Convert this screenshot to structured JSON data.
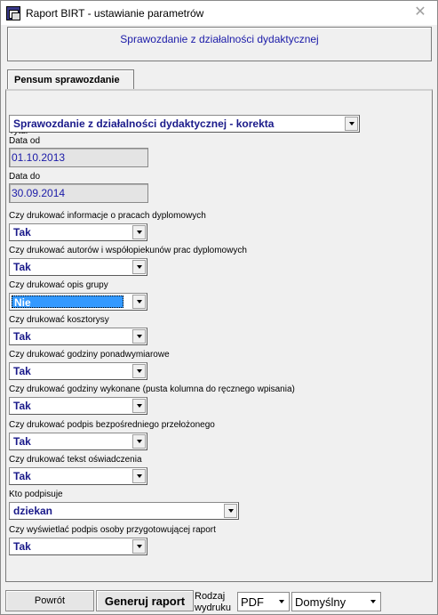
{
  "window": {
    "title": "Raport BIRT - ustawianie parametrów",
    "close_glyph": "✕"
  },
  "header": {
    "report_name": "Sprawozdanie z działalności dydaktycznej"
  },
  "tabs": [
    {
      "label": "Pensum sprawozdanie"
    }
  ],
  "form": {
    "tytul": {
      "label": "Tytuł",
      "value": "Sprawozdanie z działalności dydaktycznej - korekta"
    },
    "data_od": {
      "label": "Data od",
      "value": "01.10.2013"
    },
    "data_do": {
      "label": "Data do",
      "value": "30.09.2014"
    },
    "params": [
      {
        "label": "Czy drukować informacje o pracach dyplomowych",
        "value": "Tak"
      },
      {
        "label": "Czy drukować autorów i współopiekunów prac dyplomowych",
        "value": "Tak"
      },
      {
        "label": "Czy drukować opis grupy",
        "value": "Nie"
      },
      {
        "label": "Czy drukować kosztorysy",
        "value": "Tak"
      },
      {
        "label": "Czy drukować godziny ponadwymiarowe",
        "value": "Tak"
      },
      {
        "label": "Czy drukować godziny wykonane (pusta kolumna do ręcznego wpisania)",
        "value": "Tak"
      },
      {
        "label": "Czy drukować podpis bezpośredniego przełożonego",
        "value": "Tak"
      },
      {
        "label": "Czy drukować tekst oświadczenia",
        "value": "Tak"
      }
    ],
    "kto_podpisuje": {
      "label": "Kto podpisuje",
      "value": "dziekan"
    },
    "podpis_przygotowujacej": {
      "label": "Czy wyświetlać podpis osoby przygotowującej raport",
      "value": "Tak"
    }
  },
  "footer": {
    "back_label": "Powrót",
    "generate_label": "Generuj raport",
    "print_type_label": "Rodzaj wydruku",
    "format_value": "PDF",
    "mode_value": "Domyślny"
  },
  "colors": {
    "accent_text": "#1a1aa8",
    "selection": "#3399ff",
    "background": "#f0f0f0"
  },
  "icons": {
    "app": "birt-report-icon",
    "close": "close-icon",
    "dropdown": "chevron-down-icon"
  }
}
